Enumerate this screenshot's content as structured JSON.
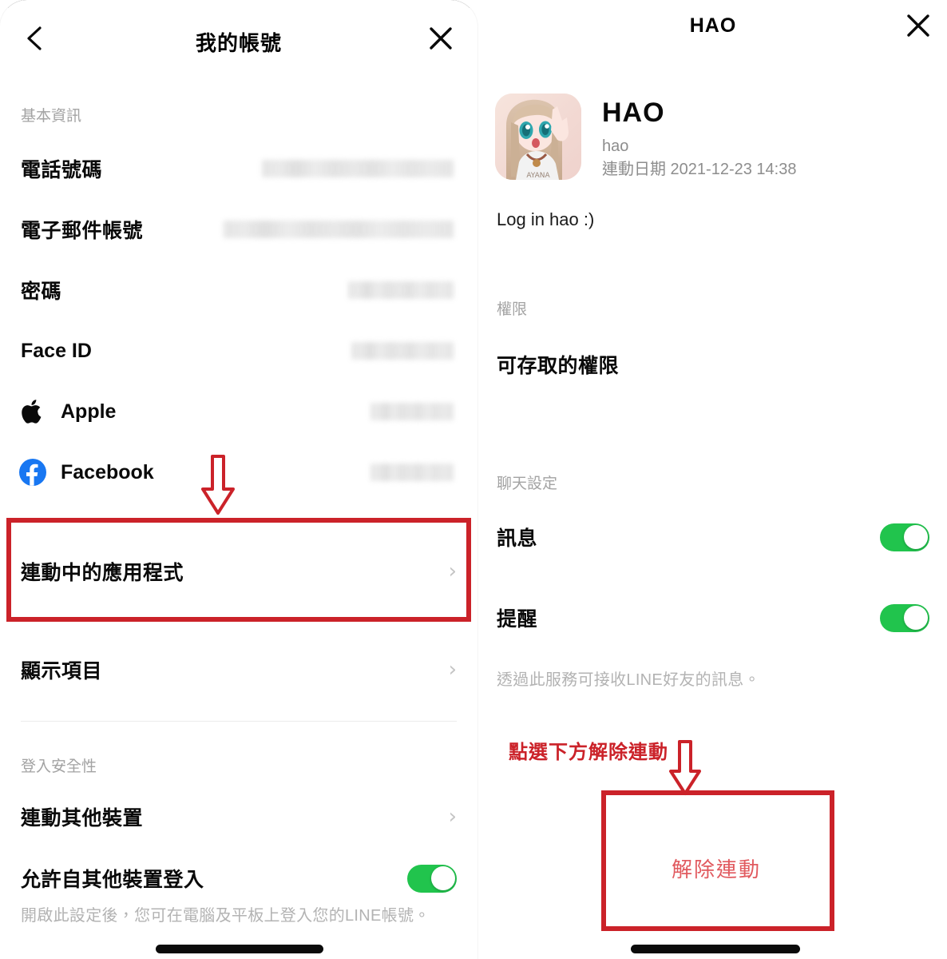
{
  "left_panel": {
    "nav": {
      "title": "我的帳號",
      "back_icon": "chevron-left-icon",
      "close_icon": "close-icon"
    },
    "basic_section_label": "基本資訊",
    "rows": [
      {
        "label": "電話號碼",
        "value_redacted": true
      },
      {
        "label": "電子郵件帳號",
        "value_redacted": true
      },
      {
        "label": "密碼",
        "value_redacted": true
      },
      {
        "label": "Face ID",
        "value_redacted": true
      },
      {
        "label": "Apple",
        "icon": "apple-icon",
        "value_redacted": true
      },
      {
        "label": "Facebook",
        "icon": "facebook-icon",
        "value_redacted": true
      }
    ],
    "linked_apps_label": "連動中的應用程式",
    "display_items_label": "顯示項目",
    "security_section_label": "登入安全性",
    "link_other_device_label": "連動其他裝置",
    "allow_login_label": "允許自其他裝置登入",
    "allow_login_toggle": "on",
    "allow_login_help": "開啟此設定後，您可在電腦及平板上登入您的LINE帳號。"
  },
  "right_panel": {
    "nav": {
      "title": "HAO",
      "close_icon": "close-icon"
    },
    "profile": {
      "avatar_icon": "anime-avatar-image",
      "name": "HAO",
      "handle": "hao",
      "linked_date": "連動日期 2021-12-23 14:38",
      "description": "Log in hao :)"
    },
    "permissions_section_label": "權限",
    "accessible_permissions_label": "可存取的權限",
    "chat_section_label": "聊天設定",
    "chat_rows": [
      {
        "label": "訊息",
        "toggle": "on"
      },
      {
        "label": "提醒",
        "toggle": "on"
      }
    ],
    "chat_help": "透過此服務可接收LINE好友的訊息。",
    "unlink_button_label": "解除連動"
  },
  "annotations": {
    "color": "#cb2229",
    "left_arrow_icon": "arrow-down-outline-icon",
    "right_arrow_icon": "arrow-down-outline-icon",
    "right_caption": "點選下方解除連動"
  }
}
